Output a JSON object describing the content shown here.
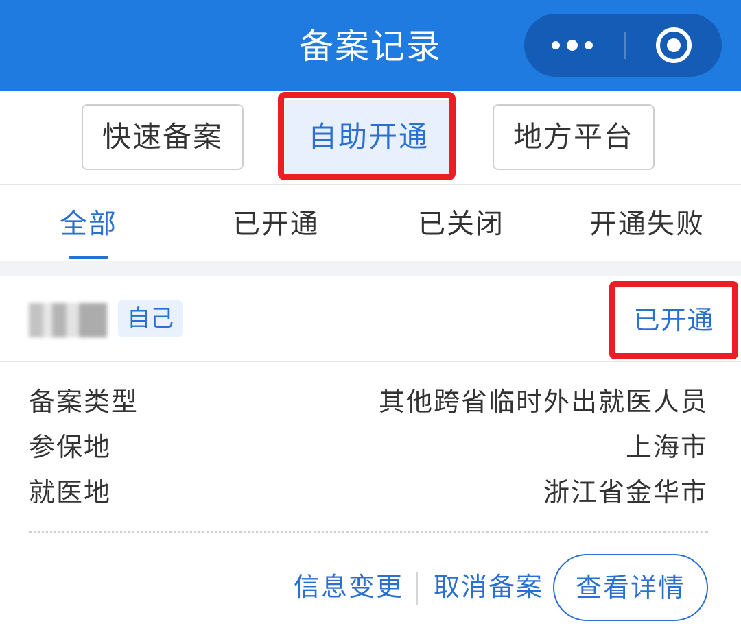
{
  "header": {
    "title": "备案记录"
  },
  "mode_buttons": [
    {
      "label": "快速备案",
      "active": false
    },
    {
      "label": "自助开通",
      "active": true
    },
    {
      "label": "地方平台",
      "active": false
    }
  ],
  "tabs": [
    {
      "label": "全部",
      "active": true
    },
    {
      "label": "已开通",
      "active": false
    },
    {
      "label": "已关闭",
      "active": false
    },
    {
      "label": "开通失败",
      "active": false
    }
  ],
  "record": {
    "relation_tag": "自己",
    "status": "已开通",
    "fields": [
      {
        "label": "备案类型",
        "value": "其他跨省临时外出就医人员"
      },
      {
        "label": "参保地",
        "value": "上海市"
      },
      {
        "label": "就医地",
        "value": "浙江省金华市"
      }
    ],
    "actions": {
      "change_info": "信息变更",
      "cancel_filing": "取消备案",
      "view_details": "查看详情"
    }
  },
  "colors": {
    "header_bg": "#1f7be0",
    "accent": "#2a6fd2",
    "highlight_box": "#ec1d24"
  }
}
